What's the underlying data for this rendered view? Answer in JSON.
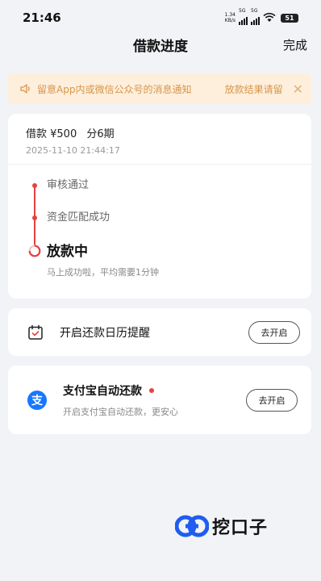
{
  "status_bar": {
    "time": "21:46",
    "net_speed_value": "1.34",
    "net_speed_unit": "KB/s",
    "signal1_label": "5G",
    "signal2_label": "5G",
    "battery": "51"
  },
  "nav": {
    "title": "借款进度",
    "done_label": "完成"
  },
  "notice": {
    "message": "留意App内或微信公众号的消息通知",
    "right_text": "放款结果请留",
    "close_icon": "close-icon"
  },
  "loan": {
    "amount_label": "借款 ¥500",
    "term_label": "分6期",
    "timestamp": "2025-11-10 21:44:17",
    "steps": [
      {
        "label": "审核通过",
        "state": "done"
      },
      {
        "label": "资金匹配成功",
        "state": "done"
      },
      {
        "label": "放款中",
        "state": "active",
        "sub": "马上成功啦，平均需要1分钟"
      }
    ],
    "accent_color": "#e84040"
  },
  "calendar_reminder": {
    "icon": "calendar-check-icon",
    "title": "开启还款日历提醒",
    "button_label": "去开启"
  },
  "alipay": {
    "icon": "alipay-icon",
    "icon_glyph": "支",
    "title": "支付宝自动还款",
    "subtitle": "开启支付宝自动还款，更安心",
    "button_label": "去开启"
  },
  "watermark": {
    "text": "挖口子"
  }
}
